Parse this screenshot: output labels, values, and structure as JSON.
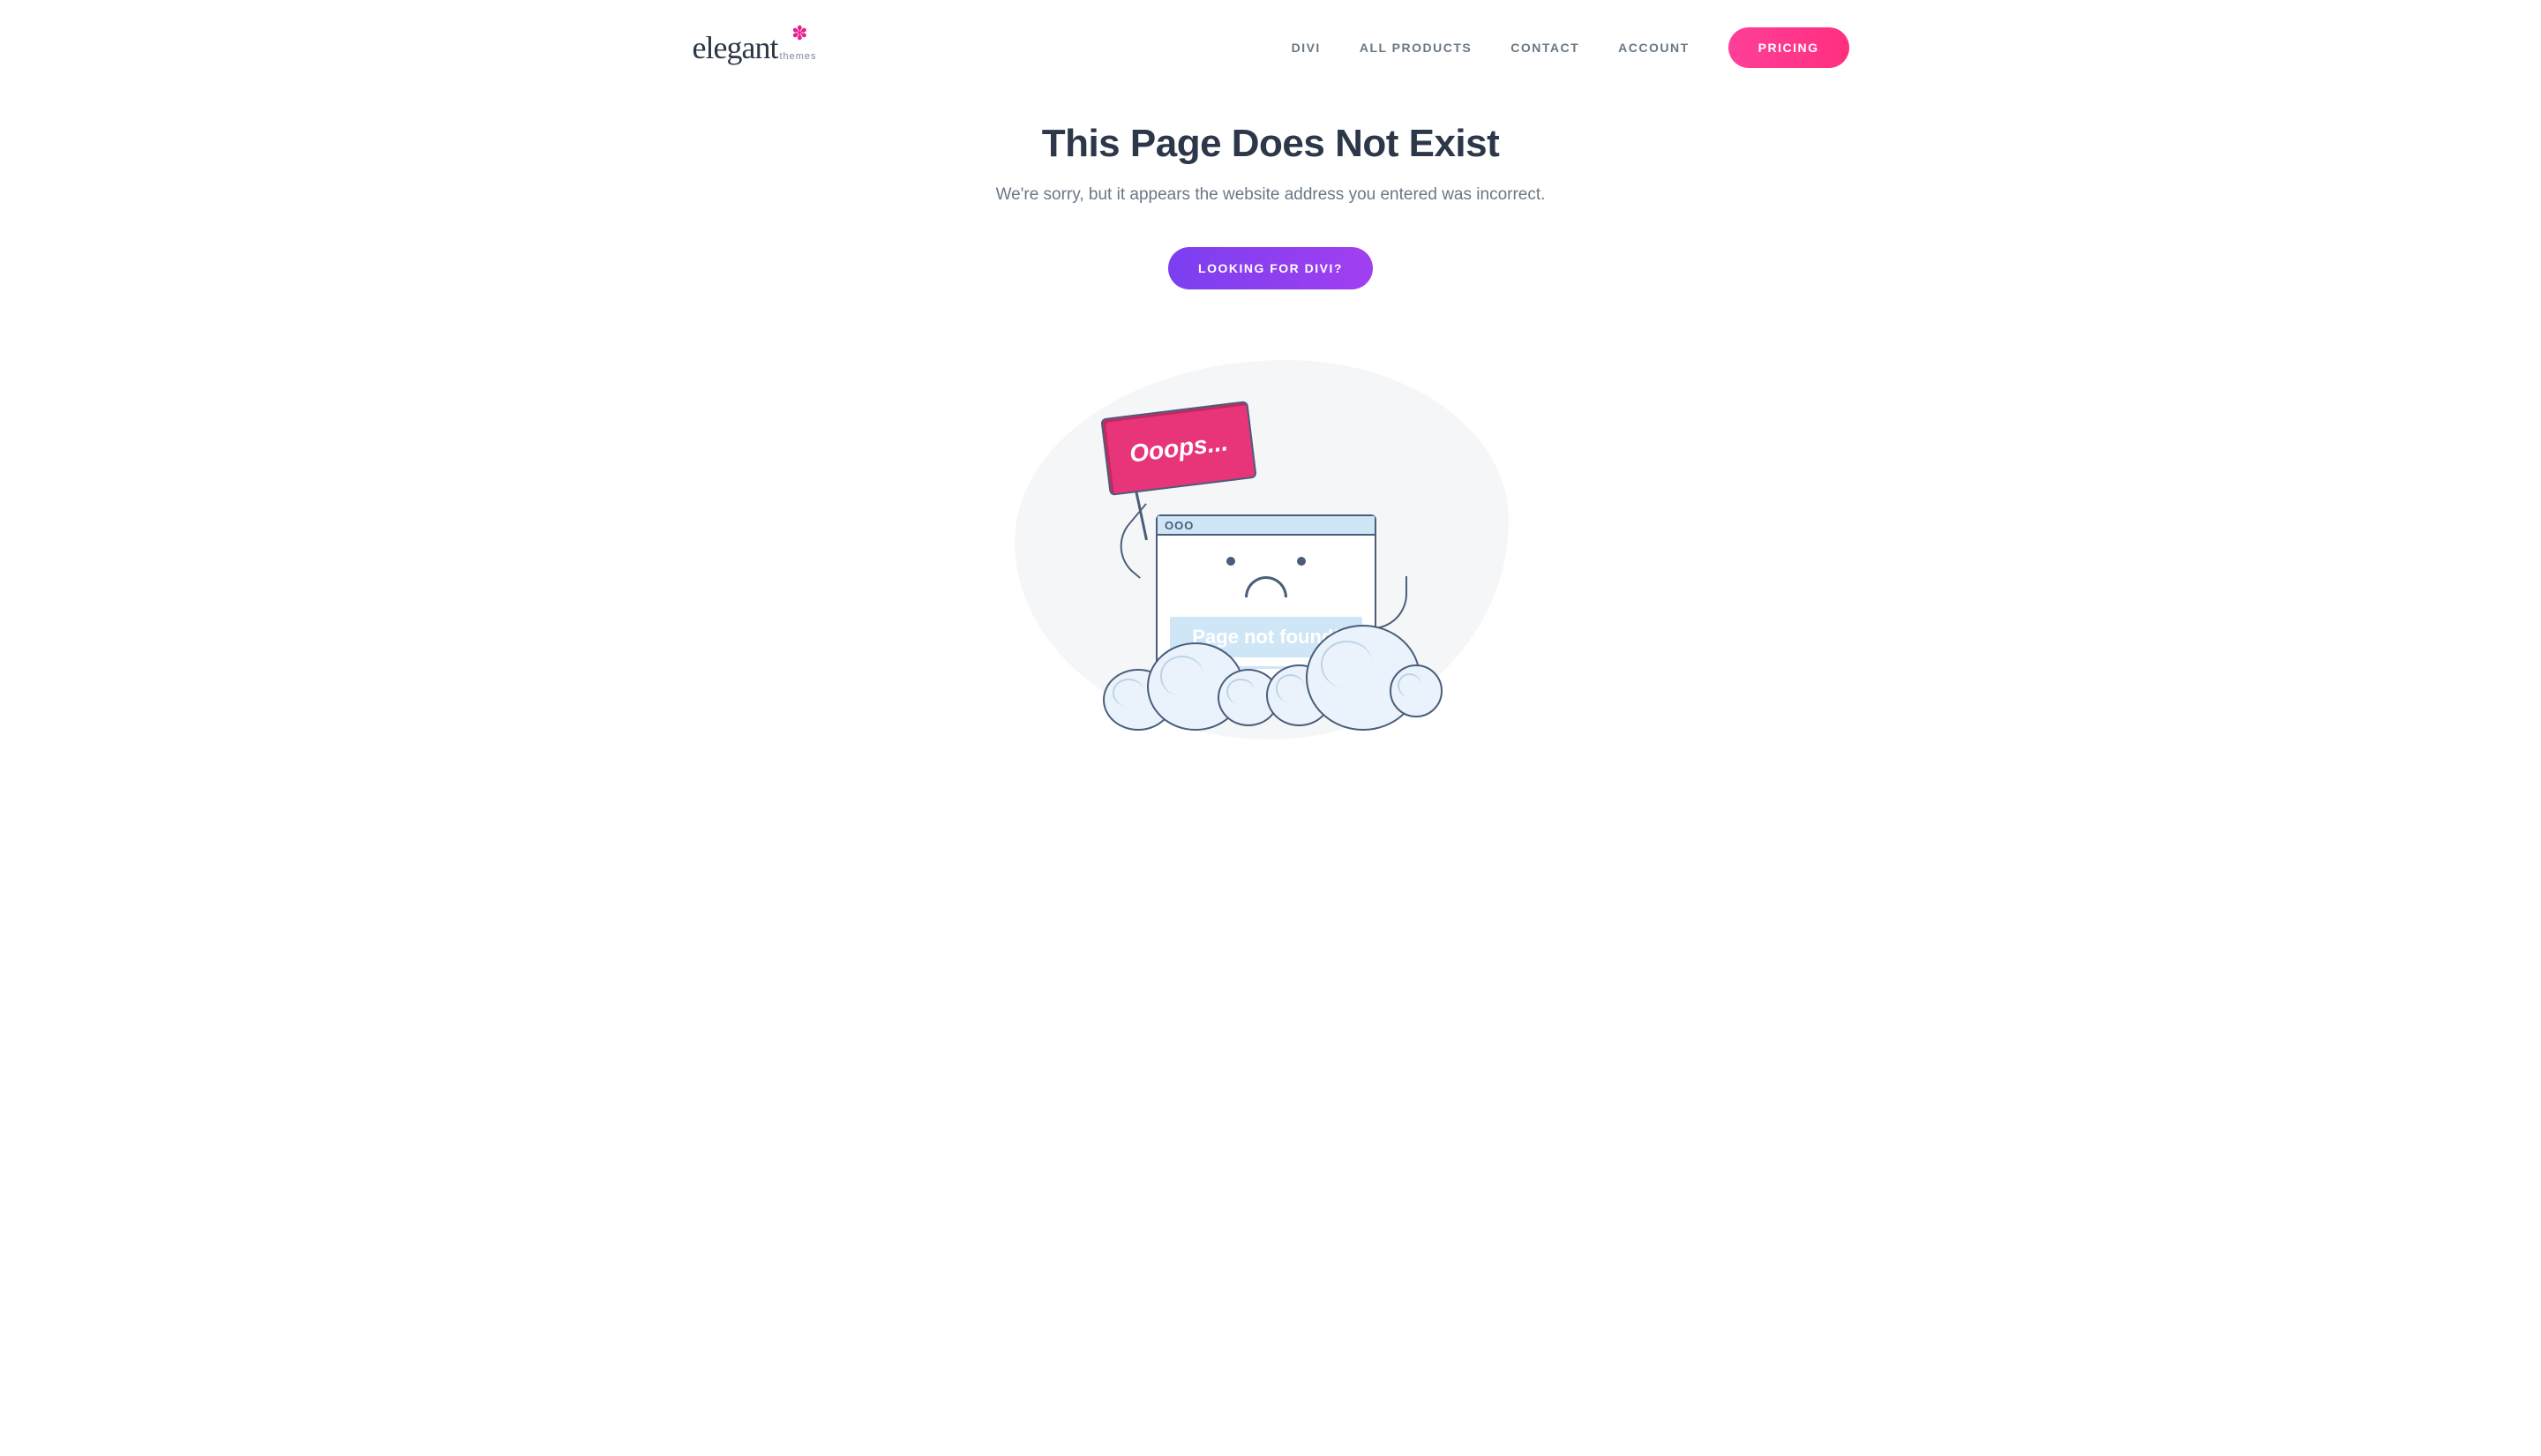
{
  "brand": {
    "word": "elegant",
    "sub": "themes"
  },
  "nav": {
    "divi": "DIVI",
    "all_products": "ALL PRODUCTS",
    "contact": "CONTACT",
    "account": "ACCOUNT",
    "pricing": "PRICING"
  },
  "main": {
    "title": "This Page Does Not Exist",
    "subtitle": "We're sorry, but it appears the website address you entered was incorrect.",
    "cta": "LOOKING FOR DIVI?"
  },
  "illustration": {
    "flag": "Ooops...",
    "titlebar": "OOO",
    "page_not_found": "Page not found!"
  }
}
